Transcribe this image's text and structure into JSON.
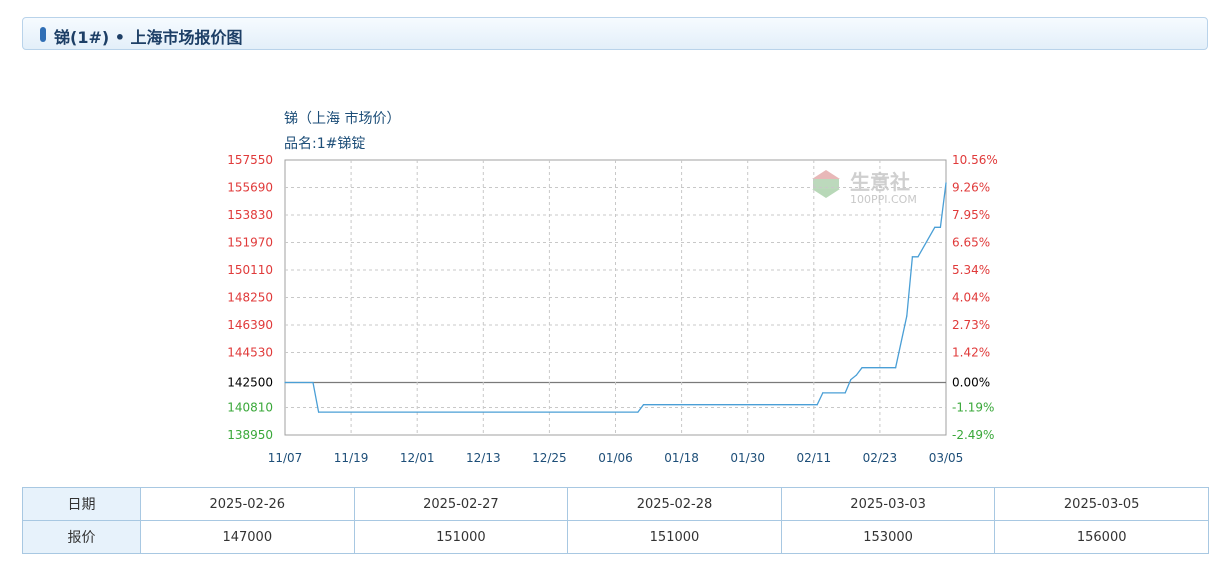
{
  "header": {
    "title": "锑(1#) • 上海市场报价图"
  },
  "chart": {
    "title": "锑（上海 市场价）",
    "subtitle": "品名:1#锑锭"
  },
  "watermark": {
    "name": "生意社",
    "site": "100PPI.COM"
  },
  "colors": {
    "line": "#4a9fd6",
    "axis_up": "#e03a3a",
    "axis_down": "#3aa83a",
    "axis_base": "#000000",
    "x_labels": "#1d4e78",
    "grid": "#c8c8c8"
  },
  "chart_data": {
    "type": "line",
    "x_tick_labels": [
      "11/07",
      "11/19",
      "12/01",
      "12/13",
      "12/25",
      "01/06",
      "01/18",
      "01/30",
      "02/11",
      "02/23",
      "03/05"
    ],
    "left_axis_ticks": [
      157550,
      155690,
      153830,
      151970,
      150110,
      148250,
      146390,
      144530,
      142500,
      140810,
      138950
    ],
    "right_axis_ticks": [
      "10.56%",
      "9.26%",
      "7.95%",
      "6.65%",
      "5.34%",
      "4.04%",
      "2.73%",
      "1.42%",
      "0.00%",
      "-1.19%",
      "-2.49%"
    ],
    "ylim": [
      138950,
      157550
    ],
    "baseline": 142500,
    "grid": true,
    "series": [
      {
        "points": [
          [
            "11/07",
            142500
          ],
          [
            "11/12",
            142500
          ],
          [
            "11/13",
            140500
          ],
          [
            "01/09",
            140500
          ],
          [
            "01/10",
            141000
          ],
          [
            "02/10",
            141000
          ],
          [
            "02/11",
            141800
          ],
          [
            "02/15",
            141800
          ],
          [
            "02/16",
            142700
          ],
          [
            "02/17",
            143000
          ],
          [
            "02/18",
            143500
          ],
          [
            "02/24",
            143500
          ],
          [
            "02/26",
            147000
          ],
          [
            "02/27",
            151000
          ],
          [
            "02/28",
            151000
          ],
          [
            "03/03",
            153000
          ],
          [
            "03/04",
            153000
          ],
          [
            "03/05",
            156000
          ]
        ]
      }
    ]
  },
  "table": {
    "row_headers": [
      "日期",
      "报价"
    ],
    "dates": [
      "2025-02-26",
      "2025-02-27",
      "2025-02-28",
      "2025-03-03",
      "2025-03-05"
    ],
    "prices": [
      "147000",
      "151000",
      "151000",
      "153000",
      "156000"
    ]
  }
}
